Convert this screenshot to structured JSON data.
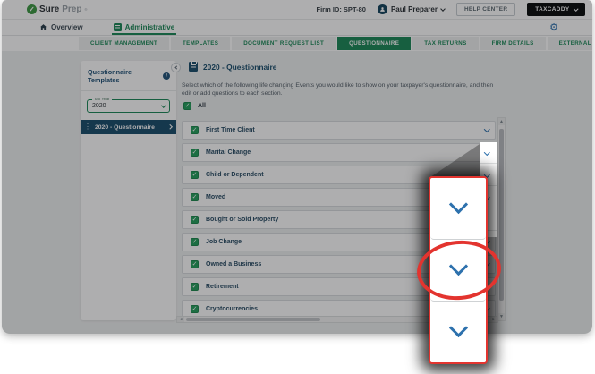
{
  "header": {
    "logo_check": "✓",
    "logo_sure": "Sure",
    "logo_prep": "Prep",
    "logo_tm": "®",
    "firm_id": "Firm ID: SPT-80",
    "user_name": "Paul Preparer",
    "help_center": "HELP CENTER",
    "taxcaddy": "TAXCADDY"
  },
  "nav": {
    "overview": "Overview",
    "administrative": "Administrative",
    "gear_icon": "⚙"
  },
  "tabs": [
    {
      "label": "CLIENT MANAGEMENT",
      "active": false
    },
    {
      "label": "TEMPLATES",
      "active": false
    },
    {
      "label": "DOCUMENT REQUEST LIST",
      "active": false
    },
    {
      "label": "QUESTIONNAIRE",
      "active": true
    },
    {
      "label": "TAX RETURNS",
      "active": false
    },
    {
      "label": "FIRM DETAILS",
      "active": false
    },
    {
      "label": "EXTERNAL CONNECTIONS",
      "active": false
    }
  ],
  "sidebar": {
    "title": "Questionnaire Templates",
    "info_icon": "i",
    "tax_year_label": "Tax Year",
    "tax_year_value": "2020",
    "template_item": "2020 - Questionnaire",
    "grip_icon": "⋮"
  },
  "main": {
    "title": "2020 - Questionnaire",
    "description": "Select which of the following life changing Events you would like to show on your taxpayer's questionnaire, and then edit or add questions to each section.",
    "all_label": "All",
    "checkbox_glyph": "✓",
    "sections": [
      "First Time Client",
      "Marital Change",
      "Child or Dependent",
      "Moved",
      "Bought or Sold Property",
      "Job Change",
      "Owned a Business",
      "Retirement",
      "Cryptocurrencies"
    ]
  },
  "scrollbars": {
    "up": "▲",
    "down": "▼",
    "left": "◄",
    "right": "►"
  },
  "annotation": {
    "type": "zoom-callout highlighting section expand chevrons",
    "magnified_chevron_count": 3,
    "circled_chevron_index": 2
  },
  "colors": {
    "brand_green": "#1f8a5a",
    "checkbox_green": "#27a05e",
    "navy": "#1c4f6e",
    "chevron_blue": "#2d71ad",
    "annotation_red": "#e3342f",
    "dim_overlay": "rgba(8,10,13,0.33)"
  }
}
